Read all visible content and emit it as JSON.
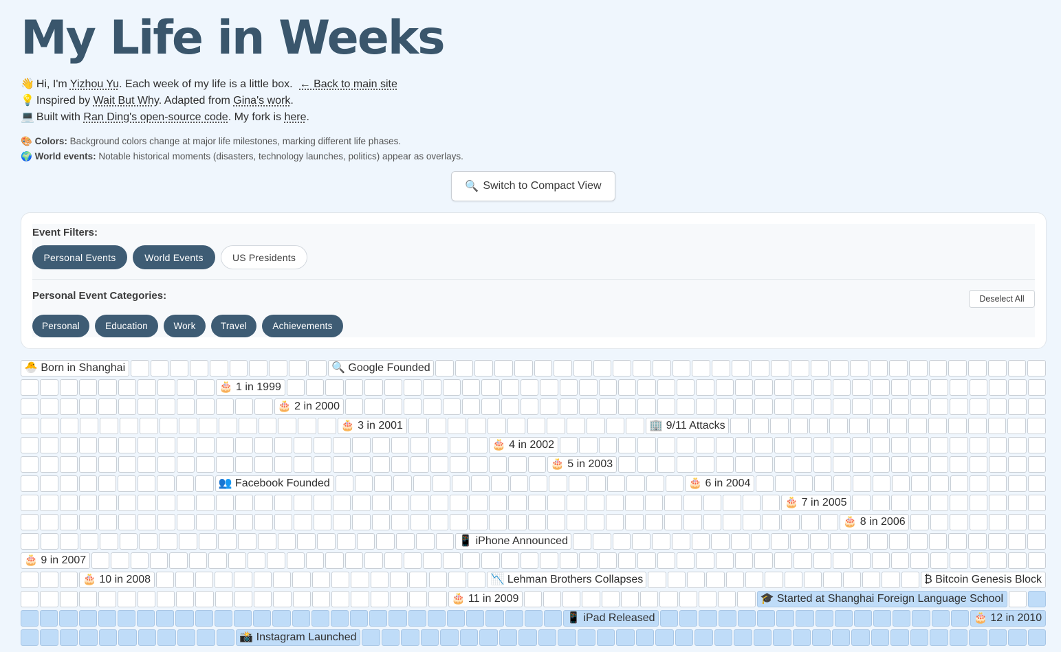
{
  "title": "My Life in Weeks",
  "intro": {
    "line1": {
      "emoji": "👋",
      "pre": "Hi, I'm ",
      "name_link": "Yizhou Yu",
      "post": ". Each week of my life is a little box.",
      "back_link": "← Back to main site"
    },
    "line2": {
      "emoji": "💡",
      "pre": "Inspired by ",
      "link1": "Wait But Why",
      "mid": ". Adapted from ",
      "link2": "Gina's work",
      "post": "."
    },
    "line3": {
      "emoji": "💻",
      "pre": "Built with ",
      "link1": "Ran Ding's open-source code",
      "mid": ". My fork is ",
      "link2": "here",
      "post": "."
    }
  },
  "notes": {
    "colors": {
      "emoji": "🎨",
      "label": "Colors:",
      "text": "Background colors change at major life milestones, marking different life phases."
    },
    "world": {
      "emoji": "🌍",
      "label": "World events:",
      "text": "Notable historical moments (disasters, technology launches, politics) appear as overlays."
    }
  },
  "switch_button": {
    "icon": "🔍",
    "label": "Switch to Compact View"
  },
  "filters": {
    "event_filters_label": "Event Filters:",
    "event_filters": [
      {
        "label": "Personal Events",
        "active": true
      },
      {
        "label": "World Events",
        "active": true
      },
      {
        "label": "US Presidents",
        "active": false
      }
    ],
    "categories_label": "Personal Event Categories:",
    "deselect_label": "Deselect All",
    "categories": [
      {
        "label": "Personal",
        "active": true
      },
      {
        "label": "Education",
        "active": true
      },
      {
        "label": "Work",
        "active": true
      },
      {
        "label": "Travel",
        "active": true
      },
      {
        "label": "Achievements",
        "active": true
      }
    ]
  },
  "colors": {
    "background": "#eff6fd",
    "title": "#3a566c",
    "chip_active": "#3e5c74",
    "phase_blue": "#bfdcf8"
  },
  "grid_rows": [
    {
      "events": [
        {
          "after": 0,
          "label": "🐣 Born in Shanghai"
        },
        {
          "after": 10,
          "label": "🔍 Google Founded"
        }
      ]
    },
    {
      "events": [
        {
          "after": 10,
          "label": "🎂 1 in 1999"
        }
      ]
    },
    {
      "events": [
        {
          "after": 13,
          "label": "🎂 2 in 2000"
        }
      ]
    },
    {
      "events": [
        {
          "after": 16,
          "label": "🎂 3 in 2001"
        },
        {
          "after": 28,
          "label": "🏢 9/11 Attacks"
        }
      ]
    },
    {
      "events": [
        {
          "after": 24,
          "label": "🎂 4 in 2002"
        }
      ]
    },
    {
      "events": [
        {
          "after": 27,
          "label": "🎂 5 in 2003"
        }
      ]
    },
    {
      "events": [
        {
          "after": 10,
          "label": "👥 Facebook Founded"
        },
        {
          "after": 28,
          "label": "🎂 6 in 2004"
        }
      ]
    },
    {
      "events": [
        {
          "after": 39,
          "label": "🎂 7 in 2005"
        }
      ]
    },
    {
      "events": [
        {
          "after": 42,
          "label": "🎂 8 in 2006"
        }
      ]
    },
    {
      "events": [
        {
          "after": 22,
          "label": "📱 iPhone Announced"
        }
      ]
    },
    {
      "events": [
        {
          "after": 0,
          "label": "🎂 9 in 2007"
        }
      ]
    },
    {
      "events": [
        {
          "after": 3,
          "label": "🎂 10 in 2008"
        },
        {
          "after": 20,
          "label": "📉 Lehman Brothers Collapses"
        },
        {
          "after": 41,
          "label": "₿ Bitcoin Genesis Block"
        }
      ]
    },
    {
      "events": [
        {
          "after": 22,
          "label": "🎂 11 in 2009"
        },
        {
          "after": 34,
          "label": "🎓 Started at Shanghai Foreign Language School",
          "phase": "blue"
        }
      ],
      "phase_from": 35
    },
    {
      "events": [
        {
          "after": 28,
          "label": "📱 iPad Released"
        },
        {
          "after": 44,
          "label": "🎂 12 in 2010"
        }
      ],
      "phase_all": true
    },
    {
      "events": [
        {
          "after": 11,
          "label": "📸 Instagram Launched"
        }
      ],
      "phase_all": true
    }
  ]
}
